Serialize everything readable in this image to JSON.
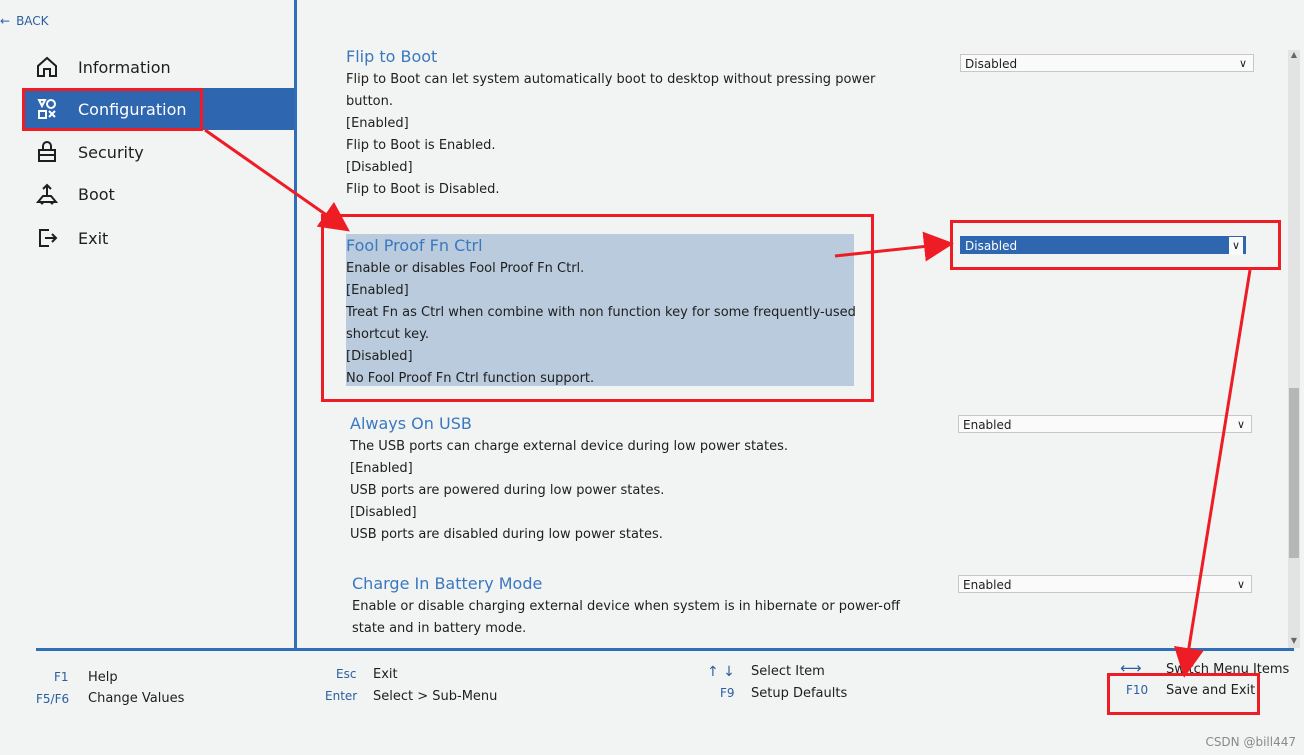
{
  "header": {
    "back_label": "BACK"
  },
  "sidebar": {
    "items": [
      {
        "label": "Information",
        "icon": "home-icon",
        "active": false
      },
      {
        "label": "Configuration",
        "icon": "configuration-icon",
        "active": true
      },
      {
        "label": "Security",
        "icon": "lock-icon",
        "active": false
      },
      {
        "label": "Boot",
        "icon": "boot-icon",
        "active": false
      },
      {
        "label": "Exit",
        "icon": "exit-icon",
        "active": false
      }
    ]
  },
  "settings": {
    "flip_to_boot": {
      "title": "Flip to Boot",
      "desc1": "Flip to Boot can let system automatically boot to desktop without pressing power",
      "desc2": "button.",
      "enabled_opt": "[Enabled]",
      "enabled_desc": "Flip to Boot is Enabled.",
      "disabled_opt": "[Disabled]",
      "disabled_desc": "Flip to Boot is Disabled.",
      "value": "Disabled"
    },
    "fool_proof": {
      "title": "Fool Proof Fn Ctrl",
      "desc1": "Enable or disables Fool Proof Fn Ctrl.",
      "enabled_opt": "[Enabled]",
      "enabled_desc1": "Treat Fn as Ctrl when combine with non function key for some frequently-used",
      "enabled_desc2": "shortcut key.",
      "disabled_opt": "[Disabled]",
      "disabled_desc": "No Fool Proof Fn Ctrl function support.",
      "value": "Disabled"
    },
    "always_on_usb": {
      "title": "Always On USB",
      "desc1": "The USB ports can charge external device during low power states.",
      "enabled_opt": "[Enabled]",
      "enabled_desc": "USB ports are powered during low power states.",
      "disabled_opt": "[Disabled]",
      "disabled_desc": "USB ports are disabled during low power states.",
      "value": "Enabled"
    },
    "charge_battery": {
      "title": "Charge In Battery Mode",
      "desc1": "Enable or disable charging external device when system is in hibernate or power-off",
      "desc2": "state and in battery mode.",
      "value": "Enabled"
    }
  },
  "footer": {
    "f1_key": "F1",
    "f1_desc": "Help",
    "f5_key": "F5/F6",
    "f5_desc": "Change Values",
    "esc_key": "Esc",
    "esc_desc": "Exit",
    "enter_key": "Enter",
    "enter_desc": "Select > Sub-Menu",
    "arrows_key": "↑ ↓",
    "arrows_desc": "Select Item",
    "f9_key": "F9",
    "f9_desc": "Setup Defaults",
    "lr_key": "⟷",
    "lr_desc": "Switch Menu Items",
    "f10_key": "F10",
    "f10_desc": "Save and Exit"
  },
  "watermark": "CSDN @bill447",
  "colors": {
    "accent": "#2e66b0",
    "annotation": "#ee1c24",
    "highlight": "#b9cbdc"
  }
}
